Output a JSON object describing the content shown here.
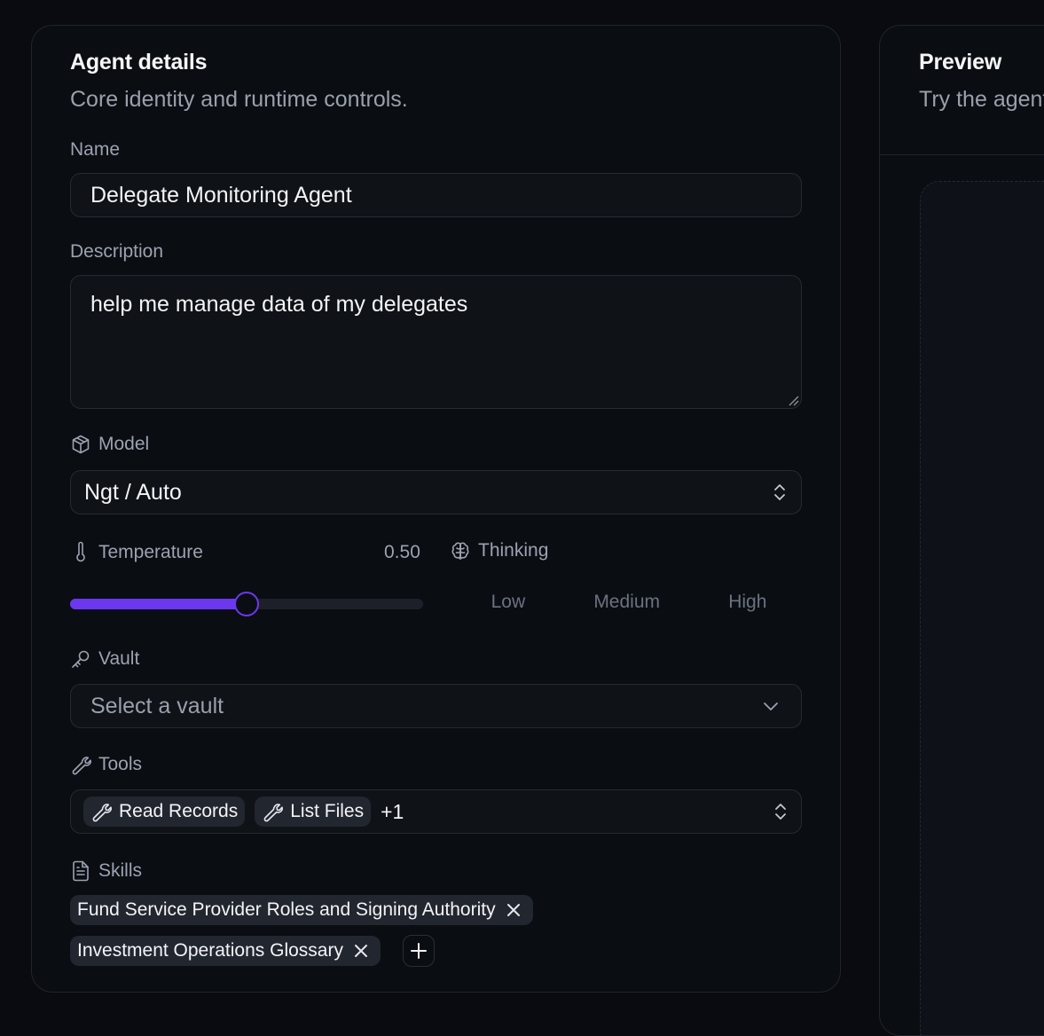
{
  "agent_details": {
    "title": "Agent details",
    "subtitle": "Core identity and runtime controls.",
    "name_label": "Name",
    "name_value": "Delegate Monitoring Agent",
    "description_label": "Description",
    "description_value": "help me manage data of my delegates",
    "model_label": "Model",
    "model_value": "Ngt / Auto",
    "temperature_label": "Temperature",
    "temperature_display": "0.50",
    "temperature_fraction": 0.5,
    "thinking_label": "Thinking",
    "thinking_options": [
      "Low",
      "Medium",
      "High"
    ],
    "vault_label": "Vault",
    "vault_placeholder": "Select a vault",
    "tools_label": "Tools",
    "tools": [
      "Read Records",
      "List Files"
    ],
    "tools_more": "+1",
    "skills_label": "Skills",
    "skills": [
      "Fund Service Provider Roles and Signing Authority",
      "Investment Operations Glossary"
    ]
  },
  "preview": {
    "title": "Preview",
    "subtitle": "Try the agent"
  },
  "icons": {
    "model": "cube-icon",
    "temperature": "thermometer-icon",
    "thinking": "brain-icon",
    "vault": "key-icon",
    "tools": "wrench-icon",
    "skills": "file-text-icon"
  },
  "colors": {
    "accent": "#6b38f0",
    "background": "#090b10"
  }
}
